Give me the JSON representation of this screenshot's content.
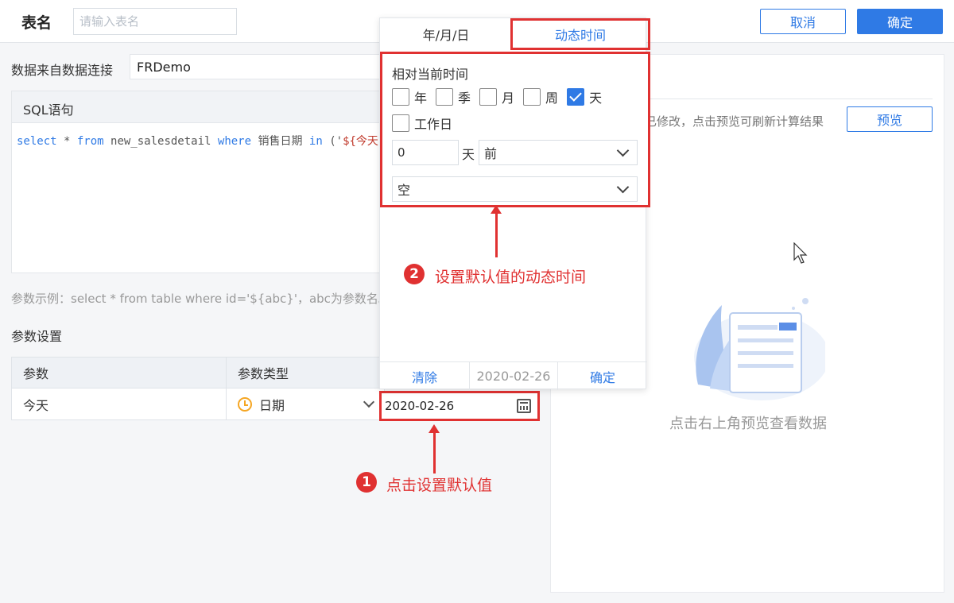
{
  "header": {
    "table_label": "表名",
    "table_placeholder": "请输入表名",
    "cancel_label": "取消",
    "confirm_label": "确定"
  },
  "connection": {
    "label": "数据来自数据连接",
    "value": "FRDemo"
  },
  "sql": {
    "title": "SQL语句",
    "code": {
      "kw_select": "select",
      "star": " * ",
      "kw_from": "from",
      "table": " new_salesdetail ",
      "kw_where": "where",
      "field": " 销售日期 ",
      "kw_in": "in",
      "paren": " ('",
      "param": "${今天"
    }
  },
  "param_example": "参数示例：select * from table where id='${abc}'，abc为参数名。",
  "param_settings": {
    "title": "参数设置",
    "columns": [
      "参数",
      "参数类型"
    ],
    "row": {
      "name": "今天",
      "type": "日期"
    },
    "date_value": "2020-02-26"
  },
  "preview": {
    "hint": "已修改，点击预览可刷新计算结果",
    "button_label": "预览",
    "empty_text": "点击右上角预览查看数据"
  },
  "popup": {
    "tabs": [
      "年/月/日",
      "动态时间"
    ],
    "relative_label": "相对当前时间",
    "checkboxes": [
      {
        "label": "年",
        "checked": false
      },
      {
        "label": "季",
        "checked": false
      },
      {
        "label": "月",
        "checked": false
      },
      {
        "label": "周",
        "checked": false
      },
      {
        "label": "天",
        "checked": true
      }
    ],
    "workday_label": "工作日",
    "offset_value": "0",
    "offset_unit": "天",
    "direction": "前",
    "second_select": "空",
    "footer": {
      "clear": "清除",
      "date": "2020-02-26",
      "confirm": "确定"
    }
  },
  "annotations": {
    "step1": {
      "num": "1",
      "text": "点击设置默认值"
    },
    "step2": {
      "num": "2",
      "text": "设置默认值的动态时间"
    }
  },
  "colors": {
    "accent": "#2f7ae5",
    "highlight": "#e03131",
    "warning": "#f5a623"
  }
}
